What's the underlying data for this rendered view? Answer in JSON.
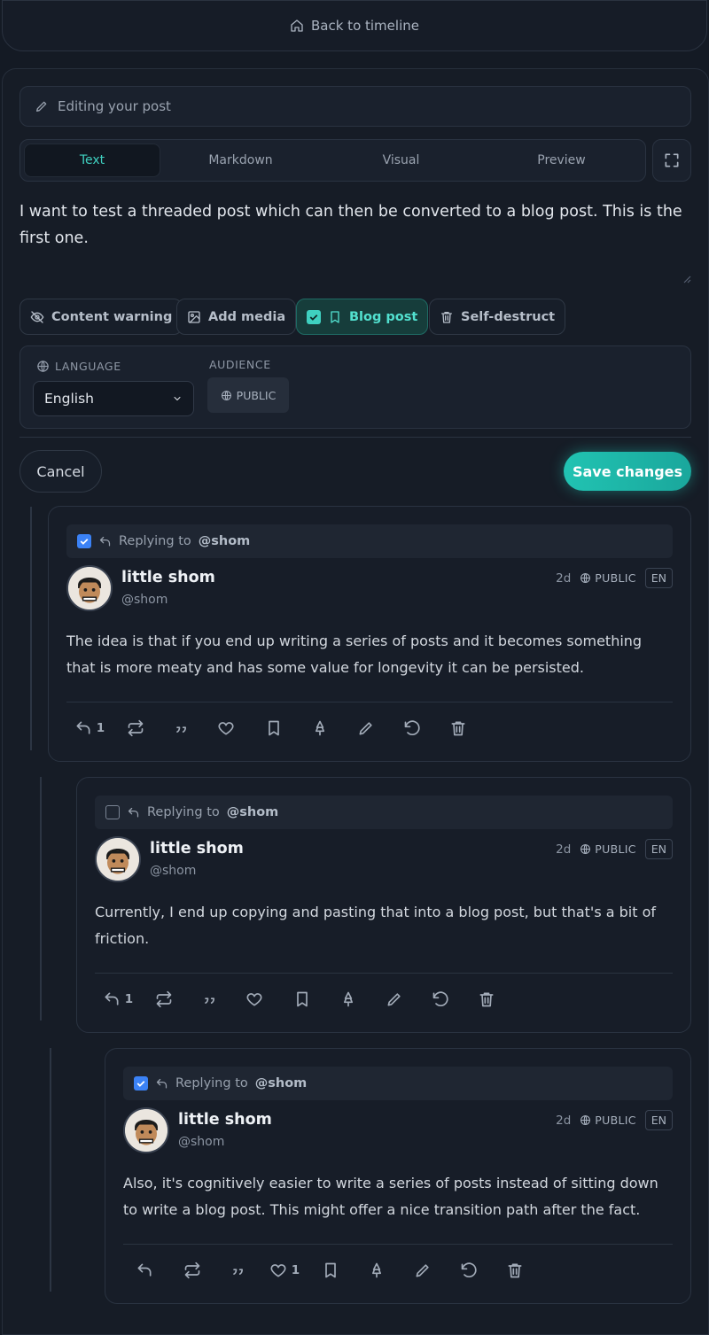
{
  "nav": {
    "back_label": "Back to timeline"
  },
  "editor": {
    "banner": "Editing your post",
    "tabs": [
      "Text",
      "Markdown",
      "Visual",
      "Preview"
    ],
    "active_tab": "Text",
    "text": "I want to test a threaded post which can then be converted to a blog post. This is the first one.",
    "options": {
      "content_warning": "Content warning",
      "add_media": "Add media",
      "blog_post": "Blog post",
      "self_destruct": "Self-destruct"
    },
    "blog_post_checked": true,
    "language_label": "LANGUAGE",
    "language_value": "English",
    "audience_label": "AUDIENCE",
    "audience_value": "PUBLIC",
    "cancel_label": "Cancel",
    "save_label": "Save changes"
  },
  "thread": [
    {
      "selected": true,
      "replying_label": "Replying to",
      "replying_to": "@shom",
      "author": "little shom",
      "handle": "@shom",
      "time": "2d",
      "visibility": "PUBLIC",
      "lang": "EN",
      "text": "The idea is that if you end up writing a series of posts and it becomes something that is more meaty and has some value for longevity it can be persisted.",
      "reply_count": "1",
      "like_count": ""
    },
    {
      "selected": false,
      "replying_label": "Replying to",
      "replying_to": "@shom",
      "author": "little shom",
      "handle": "@shom",
      "time": "2d",
      "visibility": "PUBLIC",
      "lang": "EN",
      "text": "Currently, I end up copying and pasting that into a blog post, but that's a bit of friction.",
      "reply_count": "1",
      "like_count": ""
    },
    {
      "selected": true,
      "replying_label": "Replying to",
      "replying_to": "@shom",
      "author": "little shom",
      "handle": "@shom",
      "time": "2d",
      "visibility": "PUBLIC",
      "lang": "EN",
      "text": "Also, it's cognitively easier to write a series of posts instead of sitting down to write a blog post. This might offer a nice transition path after the fact.",
      "reply_count": "",
      "like_count": "1"
    }
  ],
  "colors": {
    "accent": "#3fd0c0",
    "save_button": "#21c3b2",
    "checkbox_blue": "#3b82f6",
    "background": "#141a24"
  }
}
